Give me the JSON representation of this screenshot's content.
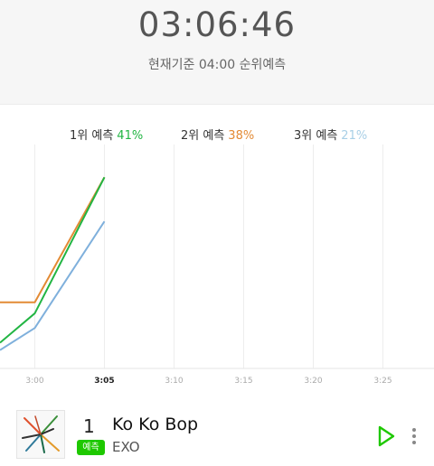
{
  "timer": "03:06:46",
  "basis_label": "현재기준 04:00 순위예측",
  "legend": [
    {
      "label": "1위 예측",
      "pct": "41%",
      "color": "#22b543"
    },
    {
      "label": "2위 예측",
      "pct": "38%",
      "color": "#e38a34"
    },
    {
      "label": "3위 예측",
      "pct": "21%",
      "color": "#a8cfe6"
    }
  ],
  "chart_data": {
    "type": "line",
    "x": [
      "2:55",
      "3:00",
      "3:05"
    ],
    "x_tick_labels": [
      "3:00",
      "3:05",
      "3:10",
      "3:15",
      "3:20",
      "3:25"
    ],
    "highlight_tick": "3:05",
    "grid": true,
    "series": [
      {
        "name": "2위 예측",
        "color": "#e38a34",
        "values": [
          12,
          12,
          46
        ]
      },
      {
        "name": "1위 예측",
        "color": "#22b543",
        "values": [
          1,
          9,
          46
        ]
      },
      {
        "name": "3위 예측",
        "color": "#7fb0dc",
        "values": [
          -1,
          5,
          34
        ]
      }
    ],
    "ylim": [
      -6,
      50
    ]
  },
  "song": {
    "rank": "1",
    "title": "Ko Ko Bop",
    "badge": "예측",
    "artist": "EXO"
  },
  "colors": {
    "accent_green": "#1ec800",
    "timer_text": "#555555"
  },
  "icons": {
    "play": "play-icon",
    "more": "more-vertical-icon",
    "album": "album-cover-image"
  }
}
